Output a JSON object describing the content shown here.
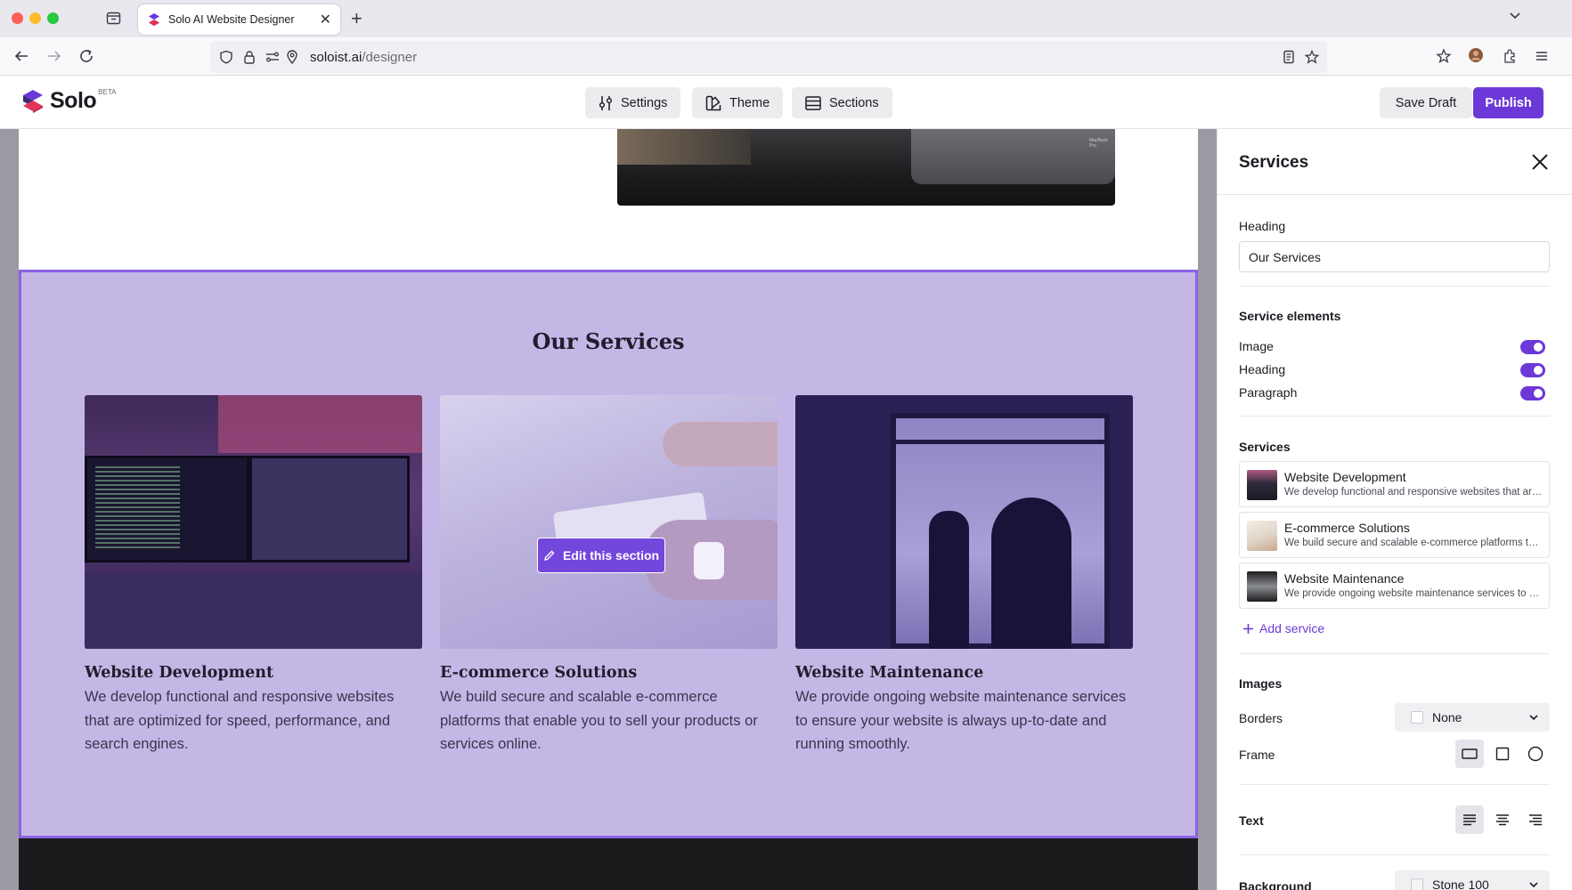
{
  "browser": {
    "tab_title": "Solo AI Website Designer",
    "url_host": "soloist.ai",
    "url_path": "/designer"
  },
  "app": {
    "logo_text": "Solo",
    "logo_badge": "BETA",
    "toolbar": {
      "settings_label": "Settings",
      "theme_label": "Theme",
      "sections_label": "Sections"
    },
    "save_draft_label": "Save Draft",
    "publish_label": "Publish",
    "accent_color": "#6d38d8"
  },
  "hero_photo_caption": "MacBook Pro",
  "services_section": {
    "heading": "Our Services",
    "background_color": "#c4b7e5",
    "edit_label": "Edit this section",
    "cards": [
      {
        "title": "Website Development",
        "text": "We develop functional and responsive websites that are optimized for speed, performance, and search engines."
      },
      {
        "title": "E-commerce Solutions",
        "text": "We build secure and scalable e-commerce platforms that enable you to sell your products or services online."
      },
      {
        "title": "Website Maintenance",
        "text": "We provide ongoing website maintenance services to ensure your website is always up-to-date and running smoothly."
      }
    ]
  },
  "panel": {
    "title": "Services",
    "heading_label": "Heading",
    "heading_value": "Our Services",
    "elements_title": "Service elements",
    "elements": [
      {
        "label": "Image",
        "enabled": true
      },
      {
        "label": "Heading",
        "enabled": true
      },
      {
        "label": "Paragraph",
        "enabled": true
      }
    ],
    "services_title": "Services",
    "services": [
      {
        "name": "Website Development",
        "desc": "We develop functional and responsive websites that are optimized for speed, performance, and search engines."
      },
      {
        "name": "E-commerce Solutions",
        "desc": "We build secure and scalable e-commerce platforms that enable you to sell your products or services online."
      },
      {
        "name": "Website Maintenance",
        "desc": "We provide ongoing website maintenance services to ensure your website is always up-to-date and running smoothly."
      }
    ],
    "add_service_label": "Add service",
    "images_title": "Images",
    "borders_label": "Borders",
    "borders_value": "None",
    "frame_label": "Frame",
    "text_label": "Text",
    "background_label": "Background",
    "background_value": "Stone 100"
  }
}
